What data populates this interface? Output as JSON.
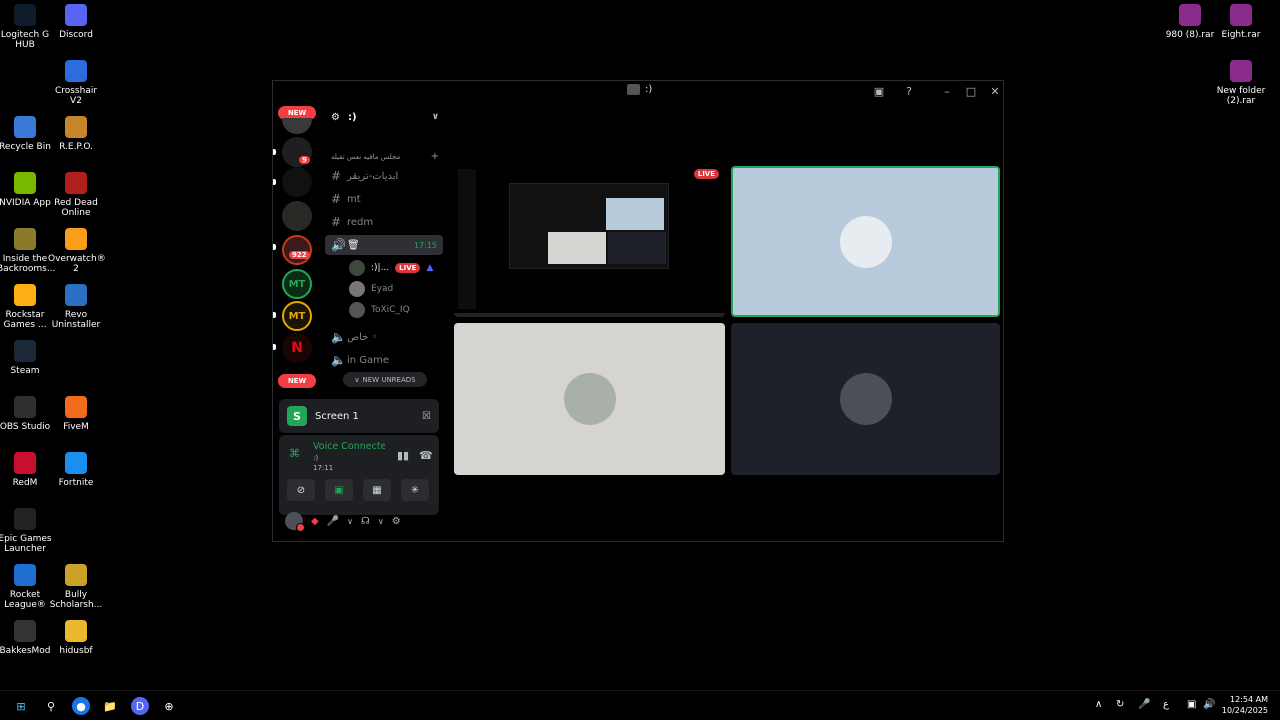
{
  "desktop": {
    "icons_left": [
      {
        "label": "Logitech G HUB",
        "icon": "logitech-icon",
        "color": "#0d1b2a"
      },
      {
        "label": "Discord",
        "icon": "discord-icon",
        "color": "#5865f2"
      },
      {
        "label": "Crosshair V2",
        "icon": "crosshair-icon",
        "color": "#2d6cdf"
      },
      {
        "label": "Recycle Bin",
        "icon": "recycle-bin-icon",
        "color": "#3b78d8"
      },
      {
        "label": "R.E.P.O.",
        "icon": "repo-icon",
        "color": "#c6842b"
      },
      {
        "label": "NVIDIA App",
        "icon": "nvidia-icon",
        "color": "#76b900"
      },
      {
        "label": "Red Dead Online",
        "icon": "red-dead-icon",
        "color": "#b01e1e"
      },
      {
        "label": "Inside the Backrooms...",
        "icon": "backrooms-icon",
        "color": "#8a7a2a"
      },
      {
        "label": "Overwatch® 2",
        "icon": "overwatch-icon",
        "color": "#f99e1a"
      },
      {
        "label": "Rockstar Games ...",
        "icon": "rockstar-icon",
        "color": "#fcaf17"
      },
      {
        "label": "Revo Uninstaller",
        "icon": "revo-icon",
        "color": "#2b6fc2"
      },
      {
        "label": "Steam",
        "icon": "steam-icon",
        "color": "#1b2838"
      },
      {
        "label": "OBS Studio",
        "icon": "obs-icon",
        "color": "#302e31"
      },
      {
        "label": "FiveM",
        "icon": "fivem-icon",
        "color": "#f26a1b"
      },
      {
        "label": "RedM",
        "icon": "redm-icon",
        "color": "#c8102e"
      },
      {
        "label": "Fortnite",
        "icon": "fortnite-icon",
        "color": "#1c8ef0"
      },
      {
        "label": "Epic Games Launcher",
        "icon": "epic-games-icon",
        "color": "#222"
      },
      {
        "label": "Rocket League®",
        "icon": "rocket-league-icon",
        "color": "#1f6fd1"
      },
      {
        "label": "Bully Scholarsh...",
        "icon": "bully-icon",
        "color": "#c9a227"
      },
      {
        "label": "BakkesMod",
        "icon": "bakkesmod-icon",
        "color": "#333"
      },
      {
        "label": "hidusbf",
        "icon": "folder-icon",
        "color": "#e8b92c"
      }
    ],
    "icons_right": [
      {
        "label": "980 (8).rar",
        "icon": "winrar-icon",
        "color": "#8b2c8c"
      },
      {
        "label": "Eight.rar",
        "icon": "winrar-icon",
        "color": "#8b2c8c"
      },
      {
        "label": "New folder (2).rar",
        "icon": "winrar-icon",
        "color": "#8b2c8c"
      }
    ]
  },
  "window": {
    "title": ":)",
    "inbox_icon": "inbox-icon",
    "help_icon": "help-icon"
  },
  "rail": {
    "new_top": "NEW",
    "new_bottom": "NEW",
    "badge_1": "9",
    "badge_2": "922",
    "mt_1": "MT",
    "mt_2": "MT"
  },
  "channels": {
    "server_name": ":)",
    "category": "مجلس مافيه نعس تقيله",
    "items": [
      {
        "label": "ابديات-تريقر",
        "type": "text"
      },
      {
        "label": "mt",
        "type": "text"
      },
      {
        "label": "redm",
        "type": "text"
      }
    ],
    "active_voice": {
      "label": "",
      "time": "17:15"
    },
    "voice_users": [
      {
        "name": ":)|...",
        "live": "LIVE"
      },
      {
        "name": "Eyad"
      },
      {
        "name": "ToXiC_IQ"
      }
    ],
    "voice_channels": [
      {
        "label": "خاص ◦"
      },
      {
        "label": "in Game"
      }
    ],
    "new_unreads": "NEW UNREADS"
  },
  "screen_panel": {
    "label": "Screen 1"
  },
  "voice_panel": {
    "status": "Voice Connected",
    "sub": ":)",
    "time": "17:11"
  },
  "tiles": {
    "live": "LIVE"
  },
  "colors": {
    "accent_green": "#23a55a",
    "live_red": "#da373c",
    "tile_1_bg": "#b7cbdc",
    "tile_2_bg": "#d6d4d1",
    "tile_3_bg": "#1e2129"
  },
  "taskbar": {
    "time": "12:54 AM",
    "date": "10/24/2025",
    "lang": "ع"
  }
}
